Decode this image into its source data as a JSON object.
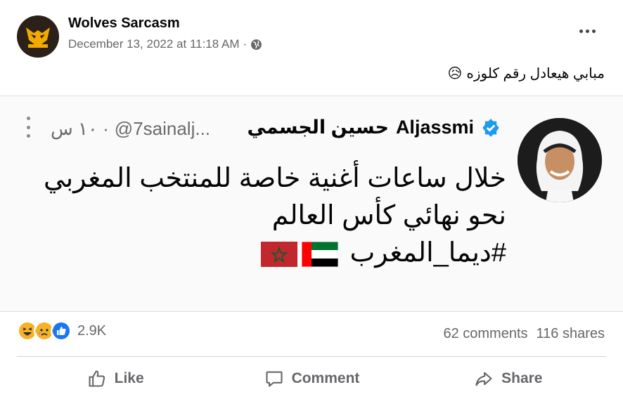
{
  "post": {
    "author": "Wolves Sarcasm",
    "timestamp": "December 13, 2022 at 11:18 AM",
    "separator": "·",
    "caption": "مبابي هيعادل رقم كلوزه",
    "caption_emoji": "😥"
  },
  "tweet": {
    "name_ar": "حسين الجسمي",
    "name_en": "Aljassmi",
    "handle": "@7sainalj...",
    "time": "· ١٠ س",
    "line1": "خلال ساعات أغنية خاصة للمنتخب المغربي",
    "line2": "نحو نهائي كأس العالم",
    "line3": "#ديما_المغرب"
  },
  "stats": {
    "reaction_count": "2.9K",
    "comments": "62 comments",
    "shares": "116 shares"
  },
  "actions": {
    "like": "Like",
    "comment": "Comment",
    "share": "Share"
  },
  "colors": {
    "text_secondary": "#65676b",
    "verified": "#1d9bf0",
    "like_blue": "#1877f2",
    "morocco_red": "#c1272d",
    "uae_green": "#00732f"
  },
  "icons": {
    "page_avatar": "wolves-logo-icon",
    "privacy": "globe-icon",
    "menu": "more-icon",
    "verified": "verified-badge-icon",
    "like": "thumbs-up-icon",
    "comment": "comment-icon",
    "share": "share-icon"
  }
}
